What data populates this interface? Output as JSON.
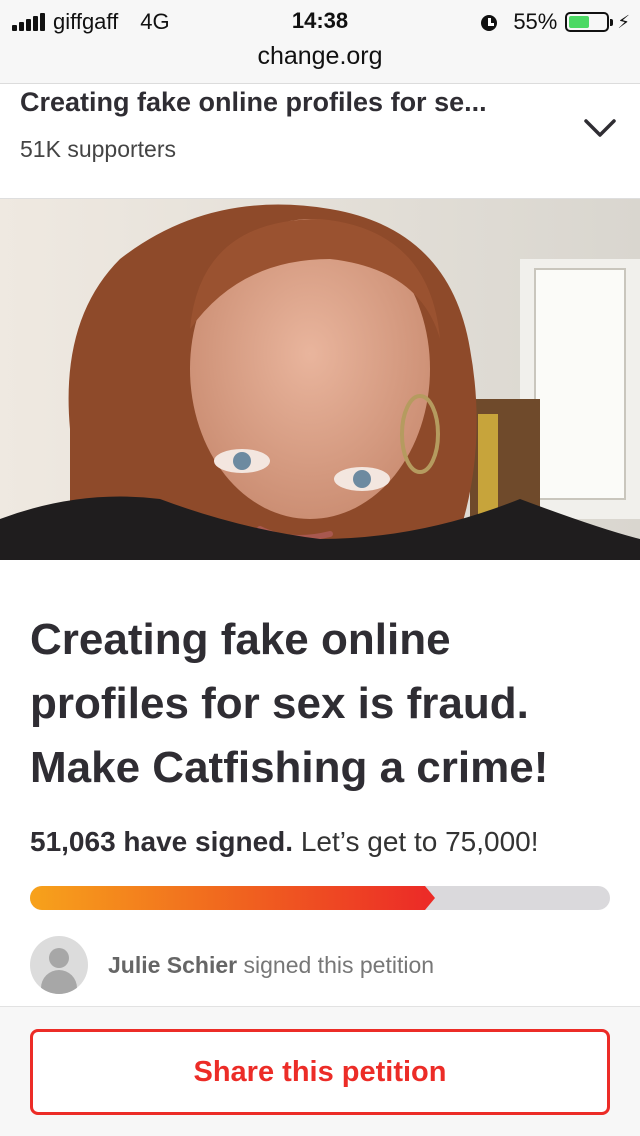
{
  "status_bar": {
    "carrier": "giffgaff",
    "network": "4G",
    "time": "14:38",
    "battery_percent": "55%",
    "battery_level": 0.55,
    "url": "change.org"
  },
  "header": {
    "title": "Creating fake online profiles for se...",
    "supporters": "51K supporters"
  },
  "petition": {
    "headline": "Creating fake online profiles for sex is fraud. Make Catfishing a crime!",
    "signed_count": "51,063 have signed.",
    "goal_text": "Let’s get to 75,000!",
    "progress_fraction": 0.6808,
    "signer_name": "Julie Schier",
    "signer_action": "signed this petition"
  },
  "actions": {
    "share_label": "Share this petition"
  },
  "colors": {
    "accent": "#ec2c27",
    "progress_start": "#f7a21b",
    "progress_end": "#ec2c27",
    "battery": "#4cd964"
  }
}
